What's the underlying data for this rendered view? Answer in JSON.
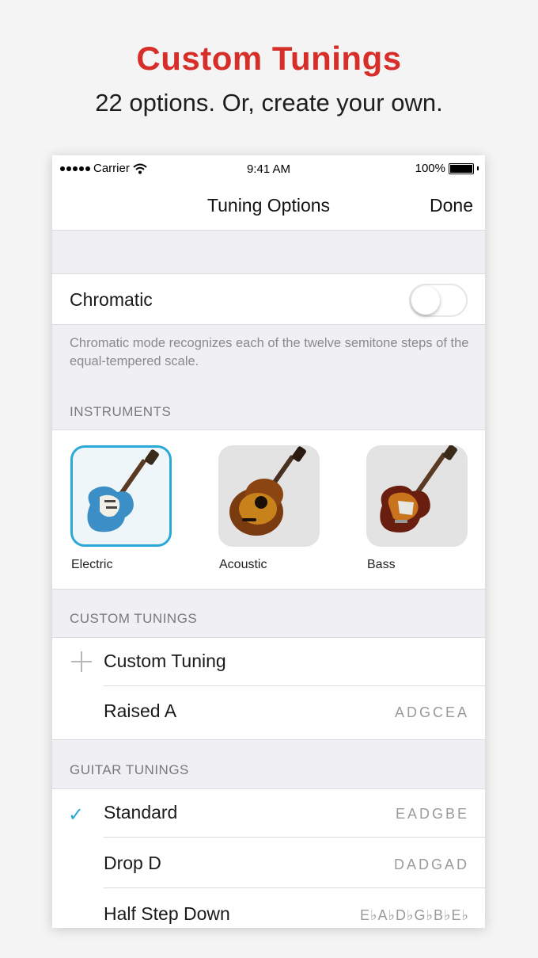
{
  "promo": {
    "headline": "Custom Tunings",
    "subline": "22 options. Or, create your own."
  },
  "status_bar": {
    "carrier": "Carrier",
    "time": "9:41 AM",
    "battery": "100%"
  },
  "nav": {
    "title": "Tuning Options",
    "done_label": "Done"
  },
  "chromatic": {
    "label": "Chromatic",
    "enabled": false,
    "description": "Chromatic mode recognizes each of the twelve semitone steps of the equal-tempered scale."
  },
  "instruments": {
    "header": "INSTRUMENTS",
    "selected": "Electric",
    "items": [
      {
        "label": "Electric",
        "icon": "electric-guitar-icon"
      },
      {
        "label": "Acoustic",
        "icon": "acoustic-guitar-icon"
      },
      {
        "label": "Bass",
        "icon": "bass-guitar-icon"
      }
    ]
  },
  "custom_tunings": {
    "header": "CUSTOM TUNINGS",
    "add_label": "Custom Tuning",
    "items": [
      {
        "label": "Raised A",
        "notes": "ADGCEA"
      }
    ]
  },
  "guitar_tunings": {
    "header": "GUITAR TUNINGS",
    "items": [
      {
        "label": "Standard",
        "notes": "EADGBE",
        "selected": true
      },
      {
        "label": "Drop D",
        "notes": "DADGAD",
        "selected": false
      },
      {
        "label": "Half Step Down",
        "notes": "E♭A♭D♭G♭B♭E♭",
        "selected": false
      }
    ]
  },
  "colors": {
    "headline": "#d62e28",
    "accent": "#2aa8d8",
    "grouped_background": "#efeff4"
  }
}
